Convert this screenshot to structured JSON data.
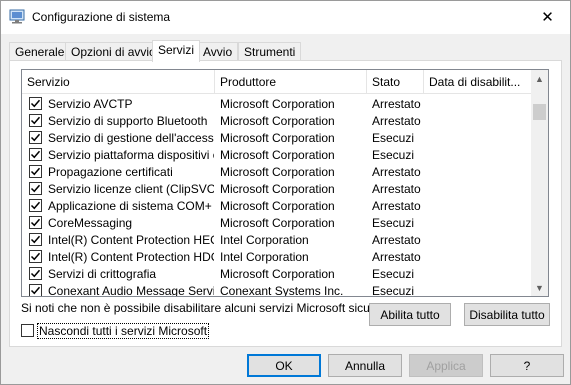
{
  "window": {
    "title": "Configurazione di sistema",
    "close_glyph": "✕"
  },
  "tabs": [
    {
      "label": "Generale"
    },
    {
      "label": "Opzioni di avvio"
    },
    {
      "label": "Servizi"
    },
    {
      "label": "Avvio"
    },
    {
      "label": "Strumenti"
    }
  ],
  "active_tab": "Servizi",
  "services": {
    "columns": [
      "Servizio",
      "Produttore",
      "Stato",
      "Data di disabilit..."
    ],
    "rows": [
      {
        "name": "Servizio AVCTP",
        "vendor": "Microsoft Corporation",
        "status": "Arrestato",
        "date": "",
        "checked": true
      },
      {
        "name": "Servizio di supporto Bluetooth",
        "vendor": "Microsoft Corporation",
        "status": "Arrestato",
        "date": "",
        "checked": true
      },
      {
        "name": "Servizio di gestione dell'accesso ...",
        "vendor": "Microsoft Corporation",
        "status": "Esecuzi",
        "date": "",
        "checked": true
      },
      {
        "name": "Servizio piattaforma dispositivi c...",
        "vendor": "Microsoft Corporation",
        "status": "Esecuzi",
        "date": "",
        "checked": true
      },
      {
        "name": "Propagazione certificati",
        "vendor": "Microsoft Corporation",
        "status": "Arrestato",
        "date": "",
        "checked": true
      },
      {
        "name": "Servizio licenze client (ClipSVC)",
        "vendor": "Microsoft Corporation",
        "status": "Arrestato",
        "date": "",
        "checked": true
      },
      {
        "name": "Applicazione di sistema COM+",
        "vendor": "Microsoft Corporation",
        "status": "Arrestato",
        "date": "",
        "checked": true
      },
      {
        "name": "CoreMessaging",
        "vendor": "Microsoft Corporation",
        "status": "Esecuzi",
        "date": "",
        "checked": true
      },
      {
        "name": "Intel(R) Content Protection HEC...",
        "vendor": "Intel Corporation",
        "status": "Arrestato",
        "date": "",
        "checked": true
      },
      {
        "name": "Intel(R) Content Protection HDC...",
        "vendor": "Intel Corporation",
        "status": "Arrestato",
        "date": "",
        "checked": true
      },
      {
        "name": "Servizi di crittografia",
        "vendor": "Microsoft Corporation",
        "status": "Esecuzi",
        "date": "",
        "checked": true
      },
      {
        "name": "Conexant Audio Message Service",
        "vendor": "Conexant Systems Inc.",
        "status": "Esecuzi",
        "date": "",
        "checked": true
      }
    ]
  },
  "note": "Si noti che non è possibile disabilitare alcuni servizi Microsoft sicuri.",
  "buttons": {
    "enable_all": "Abilita tutto",
    "disable_all": "Disabilita tutto",
    "ok": "OK",
    "cancel": "Annulla",
    "apply": "Applica",
    "help": "?"
  },
  "hide_ms": {
    "label": "Nascondi tutti i servizi Microsoft",
    "checked": false
  },
  "colors": {
    "focus_blue": "#0078d7",
    "icon_blue": "#3a6ea5"
  }
}
